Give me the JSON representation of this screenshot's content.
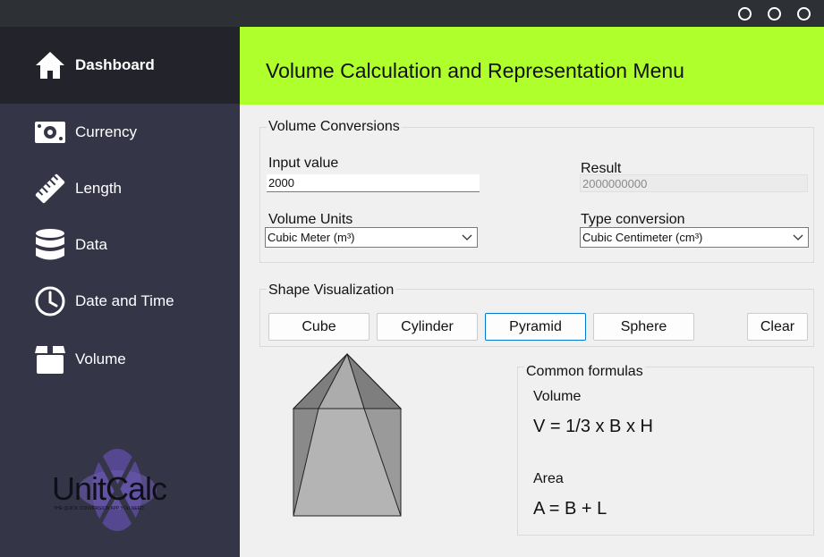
{
  "window": {
    "controls": [
      "minimize-icon",
      "maximize-icon",
      "close-icon"
    ]
  },
  "sidebar": {
    "items": [
      {
        "label": "Dashboard",
        "icon": "home-icon",
        "active": true
      },
      {
        "label": "Currency",
        "icon": "banknote-icon"
      },
      {
        "label": "Length",
        "icon": "ruler-icon"
      },
      {
        "label": "Data",
        "icon": "database-icon"
      },
      {
        "label": "Date and Time",
        "icon": "clock-icon"
      },
      {
        "label": "Volume",
        "icon": "box-icon"
      }
    ],
    "logo": {
      "name": "UnitCalc",
      "tagline": "THE QUICK CONVERSION APP YOU NEED"
    }
  },
  "header": {
    "title": "Volume Calculation and Representation Menu",
    "color": "#aeff2b"
  },
  "conversions": {
    "title": "Volume Conversions",
    "input_label": "Input value",
    "input_value": "2000",
    "result_label": "Result",
    "result_value": "2000000000",
    "units_label": "Volume Units",
    "units_value": "Cubic Meter (m³)",
    "type_label": "Type conversion",
    "type_value": "Cubic Centimeter (cm³)"
  },
  "shapes": {
    "title": "Shape Visualization",
    "buttons": [
      "Cube",
      "Cylinder",
      "Pyramid",
      "Sphere"
    ],
    "selected": "Pyramid",
    "clear_label": "Clear"
  },
  "formulas": {
    "title": "Common formulas",
    "volume_label": "Volume",
    "volume_formula": "V = 1/3 x B x H",
    "area_label": "Area",
    "area_formula": "A = B + L"
  },
  "colors": {
    "sidebar": "#353548",
    "sidebar_active": "#23232c",
    "titlebar": "#2d3035",
    "accent": "#aeff2b",
    "selected_border": "#0078d4"
  }
}
